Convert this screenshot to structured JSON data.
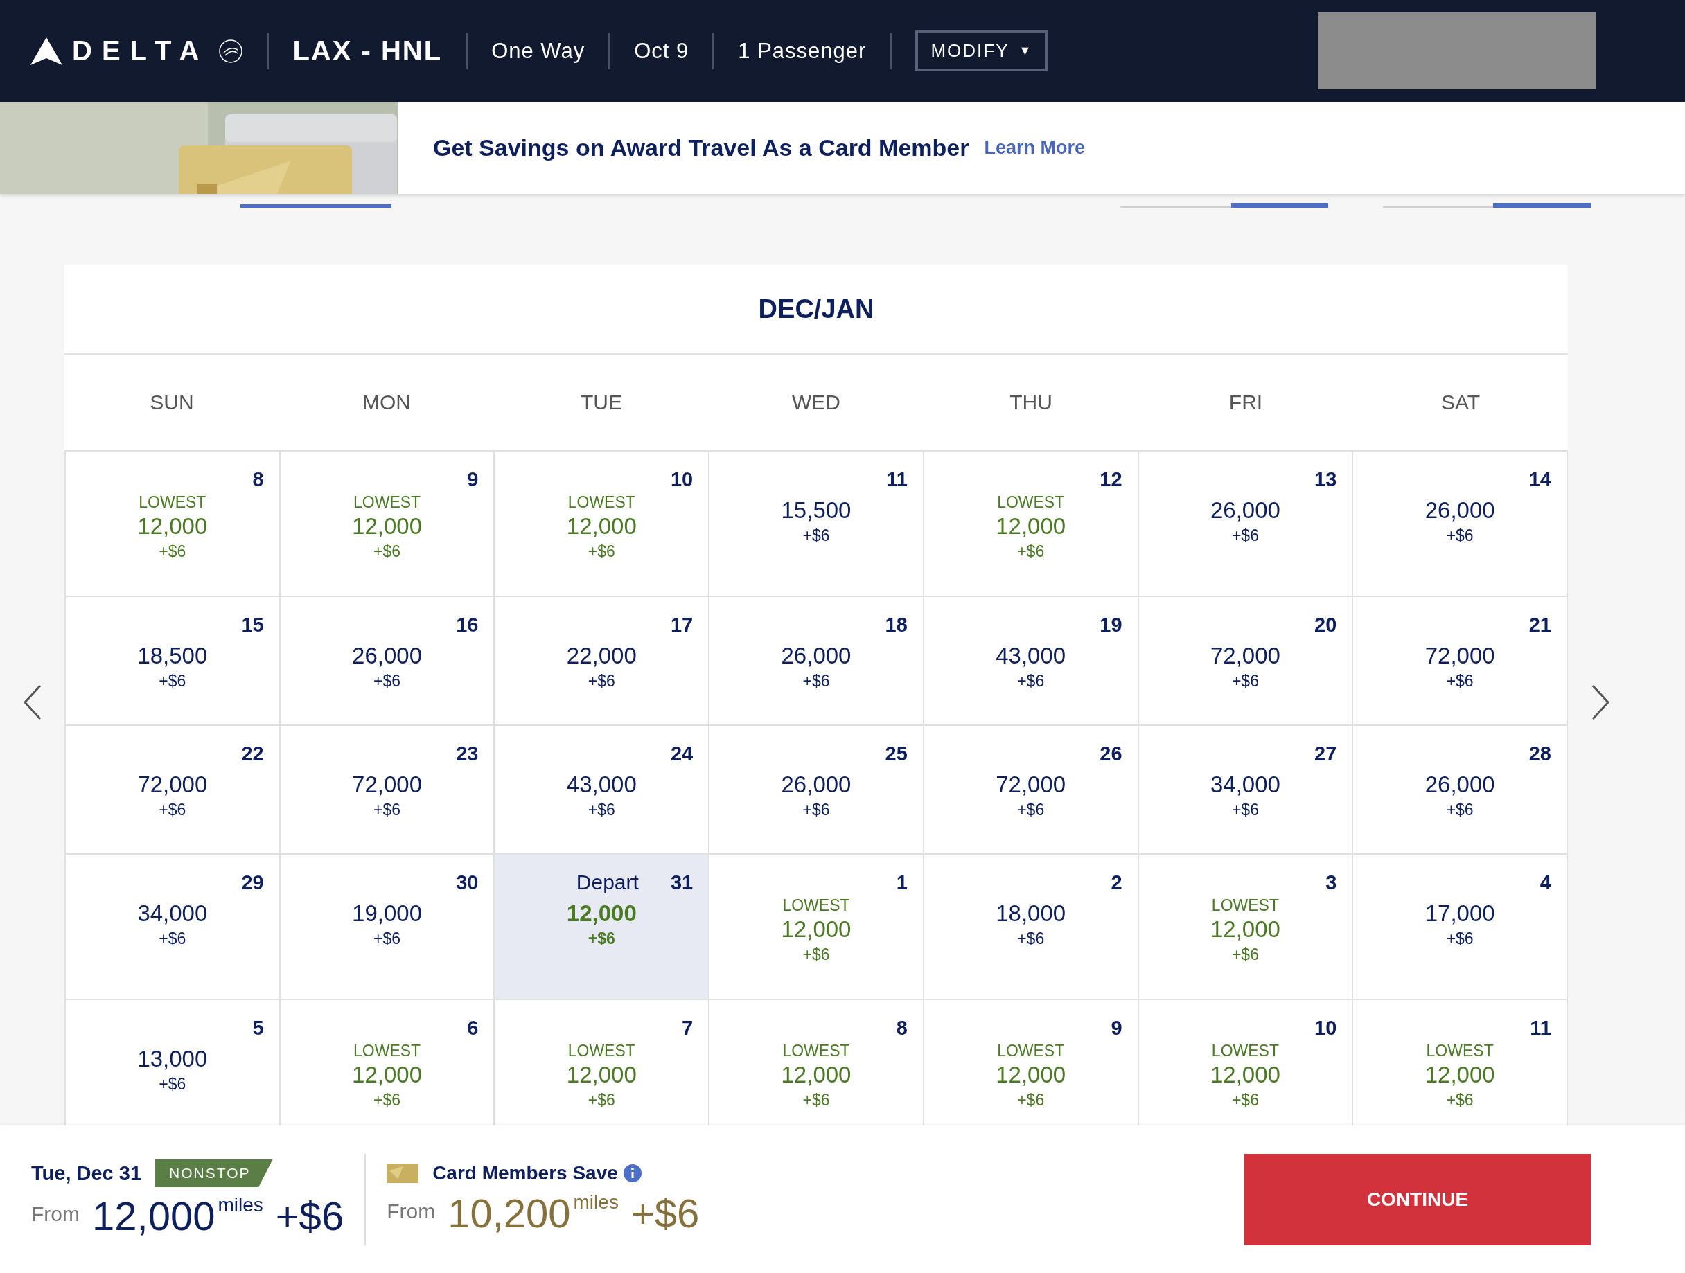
{
  "header": {
    "brand": "DELTA",
    "route": "LAX - HNL",
    "trip_type": "One Way",
    "date": "Oct 9",
    "passengers": "1 Passenger",
    "modify_button": "MODIFY",
    "caret": "▼"
  },
  "banner": {
    "headline": "Get Savings on Award Travel As a Card Member",
    "link": "Learn More"
  },
  "calendar": {
    "title": "DEC/JAN",
    "weekdays": [
      "SUN",
      "MON",
      "TUE",
      "WED",
      "THU",
      "FRI",
      "SAT"
    ],
    "weeks": [
      [
        {
          "day": "8",
          "tag": "LOWEST",
          "price": "12,000",
          "fee": "+$6",
          "selected": false
        },
        {
          "day": "9",
          "tag": "LOWEST",
          "price": "12,000",
          "fee": "+$6",
          "selected": false
        },
        {
          "day": "10",
          "tag": "LOWEST",
          "price": "12,000",
          "fee": "+$6",
          "selected": false
        },
        {
          "day": "11",
          "price": "15,500",
          "fee": "+$6",
          "selected": false
        },
        {
          "day": "12",
          "tag": "LOWEST",
          "price": "12,000",
          "fee": "+$6",
          "selected": false
        },
        {
          "day": "13",
          "price": "26,000",
          "fee": "+$6",
          "selected": false
        },
        {
          "day": "14",
          "price": "26,000",
          "fee": "+$6",
          "selected": false
        }
      ],
      [
        {
          "day": "15",
          "price": "18,500",
          "fee": "+$6",
          "selected": false
        },
        {
          "day": "16",
          "price": "26,000",
          "fee": "+$6",
          "selected": false
        },
        {
          "day": "17",
          "price": "22,000",
          "fee": "+$6",
          "selected": false
        },
        {
          "day": "18",
          "price": "26,000",
          "fee": "+$6",
          "selected": false
        },
        {
          "day": "19",
          "price": "43,000",
          "fee": "+$6",
          "selected": false
        },
        {
          "day": "20",
          "price": "72,000",
          "fee": "+$6",
          "selected": false
        },
        {
          "day": "21",
          "price": "72,000",
          "fee": "+$6",
          "selected": false
        }
      ],
      [
        {
          "day": "22",
          "price": "72,000",
          "fee": "+$6",
          "selected": false
        },
        {
          "day": "23",
          "price": "72,000",
          "fee": "+$6",
          "selected": false
        },
        {
          "day": "24",
          "price": "43,000",
          "fee": "+$6",
          "selected": false
        },
        {
          "day": "25",
          "price": "26,000",
          "fee": "+$6",
          "selected": false
        },
        {
          "day": "26",
          "price": "72,000",
          "fee": "+$6",
          "selected": false
        },
        {
          "day": "27",
          "price": "34,000",
          "fee": "+$6",
          "selected": false
        },
        {
          "day": "28",
          "price": "26,000",
          "fee": "+$6",
          "selected": false
        }
      ],
      [
        {
          "day": "29",
          "price": "34,000",
          "fee": "+$6",
          "selected": false
        },
        {
          "day": "30",
          "price": "19,000",
          "fee": "+$6",
          "selected": false
        },
        {
          "day": "31",
          "label": "Depart",
          "price": "12,000",
          "fee": "+$6",
          "selected": true
        },
        {
          "day": "1",
          "tag": "LOWEST",
          "price": "12,000",
          "fee": "+$6",
          "selected": false
        },
        {
          "day": "2",
          "price": "18,000",
          "fee": "+$6",
          "selected": false
        },
        {
          "day": "3",
          "tag": "LOWEST",
          "price": "12,000",
          "fee": "+$6",
          "selected": false
        },
        {
          "day": "4",
          "price": "17,000",
          "fee": "+$6",
          "selected": false
        }
      ],
      [
        {
          "day": "5",
          "price": "13,000",
          "fee": "+$6",
          "selected": false
        },
        {
          "day": "6",
          "tag": "LOWEST",
          "price": "12,000",
          "fee": "+$6",
          "selected": false
        },
        {
          "day": "7",
          "tag": "LOWEST",
          "price": "12,000",
          "fee": "+$6",
          "selected": false
        },
        {
          "day": "8",
          "tag": "LOWEST",
          "price": "12,000",
          "fee": "+$6",
          "selected": false
        },
        {
          "day": "9",
          "tag": "LOWEST",
          "price": "12,000",
          "fee": "+$6",
          "selected": false
        },
        {
          "day": "10",
          "tag": "LOWEST",
          "price": "12,000",
          "fee": "+$6",
          "selected": false
        },
        {
          "day": "11",
          "tag": "LOWEST",
          "price": "12,000",
          "fee": "+$6",
          "selected": false
        }
      ]
    ]
  },
  "summary": {
    "date": "Tue, Dec 31",
    "badge": "NONSTOP",
    "from": "From",
    "miles": "12,000",
    "unit": "miles",
    "fee": "+$6"
  },
  "card_offer": {
    "title": "Card Members Save",
    "from": "From",
    "miles": "10,200",
    "unit": "miles",
    "fee": "+$6"
  },
  "continue_button": "CONTINUE"
}
